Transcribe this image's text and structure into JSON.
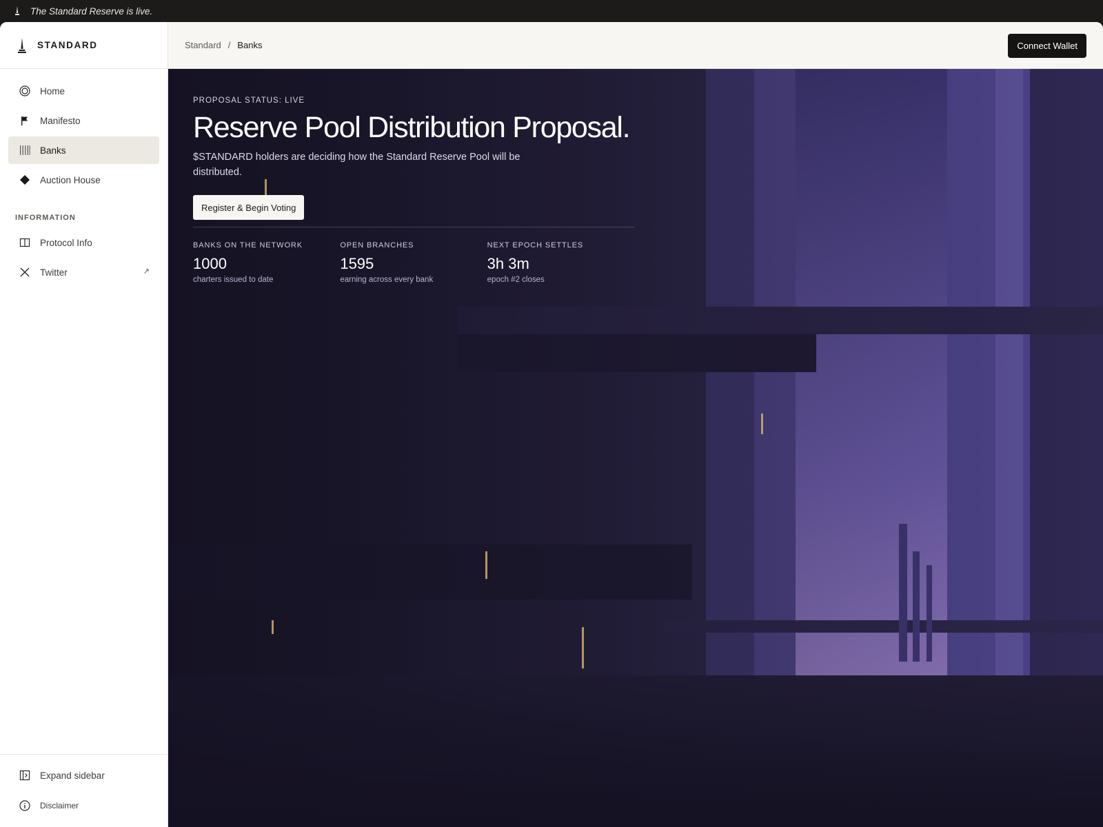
{
  "banner": {
    "text": "The Standard Reserve is live."
  },
  "brand": {
    "name": "STANDARD"
  },
  "sidebar": {
    "items": [
      {
        "label": "Home",
        "icon": "home-ring-icon"
      },
      {
        "label": "Manifesto",
        "icon": "flag-icon"
      },
      {
        "label": "Banks",
        "icon": "pillars-icon",
        "active": true
      },
      {
        "label": "Auction House",
        "icon": "diamond-icon"
      }
    ],
    "section_label": "INFORMATION",
    "info_items": [
      {
        "label": "Protocol Info",
        "icon": "book-icon"
      },
      {
        "label": "Twitter",
        "icon": "x-logo-icon",
        "external": "↗"
      }
    ],
    "bottom": {
      "expand_label": "Expand sidebar",
      "disclaimer_label": "Disclaimer"
    }
  },
  "header": {
    "breadcrumb": [
      "Standard",
      "Banks"
    ],
    "separator": "/",
    "connect_label": "Connect Wallet"
  },
  "hero": {
    "status": "PROPOSAL STATUS: LIVE",
    "title": "Reserve Pool Distribution Proposal.",
    "description": "$STANDARD holders are deciding how the Standard Reserve Pool will be distributed.",
    "cta_label": "Register & Begin Voting",
    "stats": [
      {
        "label": "BANKS ON THE NETWORK",
        "value": "1000",
        "sub": "charters issued to date"
      },
      {
        "label": "OPEN BRANCHES",
        "value": "1595",
        "sub": "earning across every bank"
      },
      {
        "label": "NEXT EPOCH SETTLES",
        "value": "3h 3m",
        "sub": "epoch #2 closes"
      }
    ]
  },
  "colors": {
    "accent_dark": "#151412",
    "active_nav": "#ece9e2",
    "hero_base": "#2a2548"
  }
}
